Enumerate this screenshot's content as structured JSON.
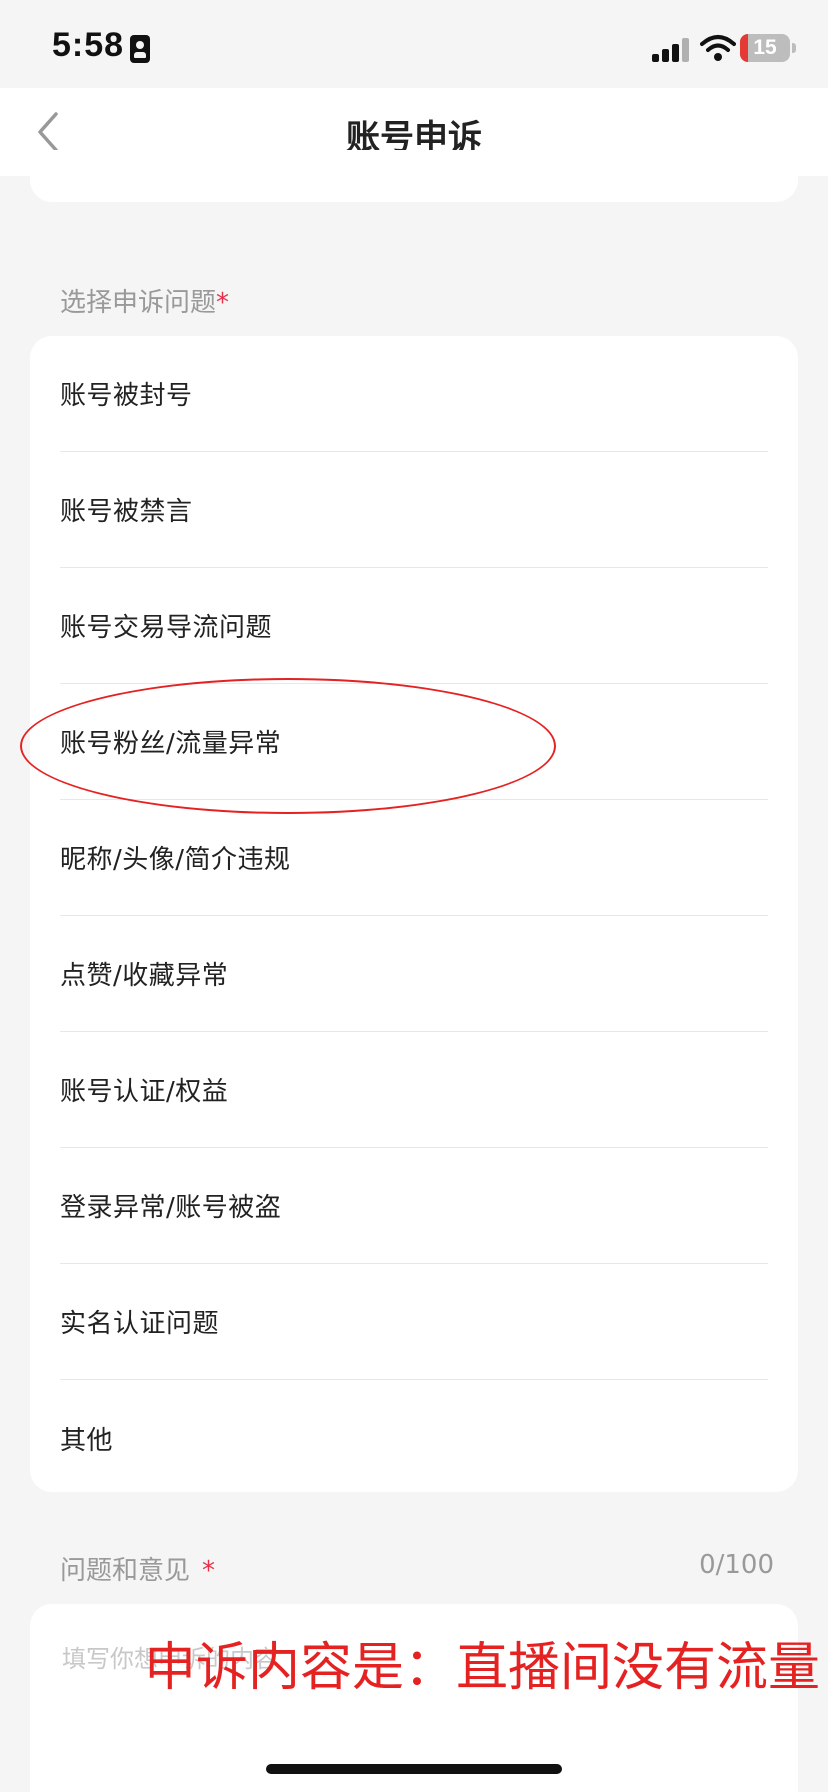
{
  "status_bar": {
    "time": "5:58",
    "battery_level": "15",
    "battery_fraction": 0.15,
    "battery_color": "#e53935"
  },
  "nav": {
    "back_icon": "chevron-left-icon",
    "title": "账号申诉"
  },
  "issue_section": {
    "label": "选择申诉问题",
    "required_mark": "*",
    "options": [
      {
        "label": "账号被封号"
      },
      {
        "label": "账号被禁言"
      },
      {
        "label": "账号交易导流问题"
      },
      {
        "label": "账号粉丝/流量异常"
      },
      {
        "label": "昵称/头像/简介违规"
      },
      {
        "label": "点赞/收藏异常"
      },
      {
        "label": "账号认证/权益"
      },
      {
        "label": "登录异常/账号被盗"
      },
      {
        "label": "实名认证问题"
      },
      {
        "label": "其他"
      }
    ]
  },
  "feedback_section": {
    "label": "问题和意见",
    "required_mark": "*",
    "counter": "0/100",
    "placeholder": "填写你想申诉的内容"
  },
  "annotation": {
    "text": "申诉内容是：直播间没有流量",
    "color": "#e52222"
  },
  "colors": {
    "accent_required": "#e5304a",
    "background": "#f5f5f5",
    "card": "#ffffff"
  }
}
